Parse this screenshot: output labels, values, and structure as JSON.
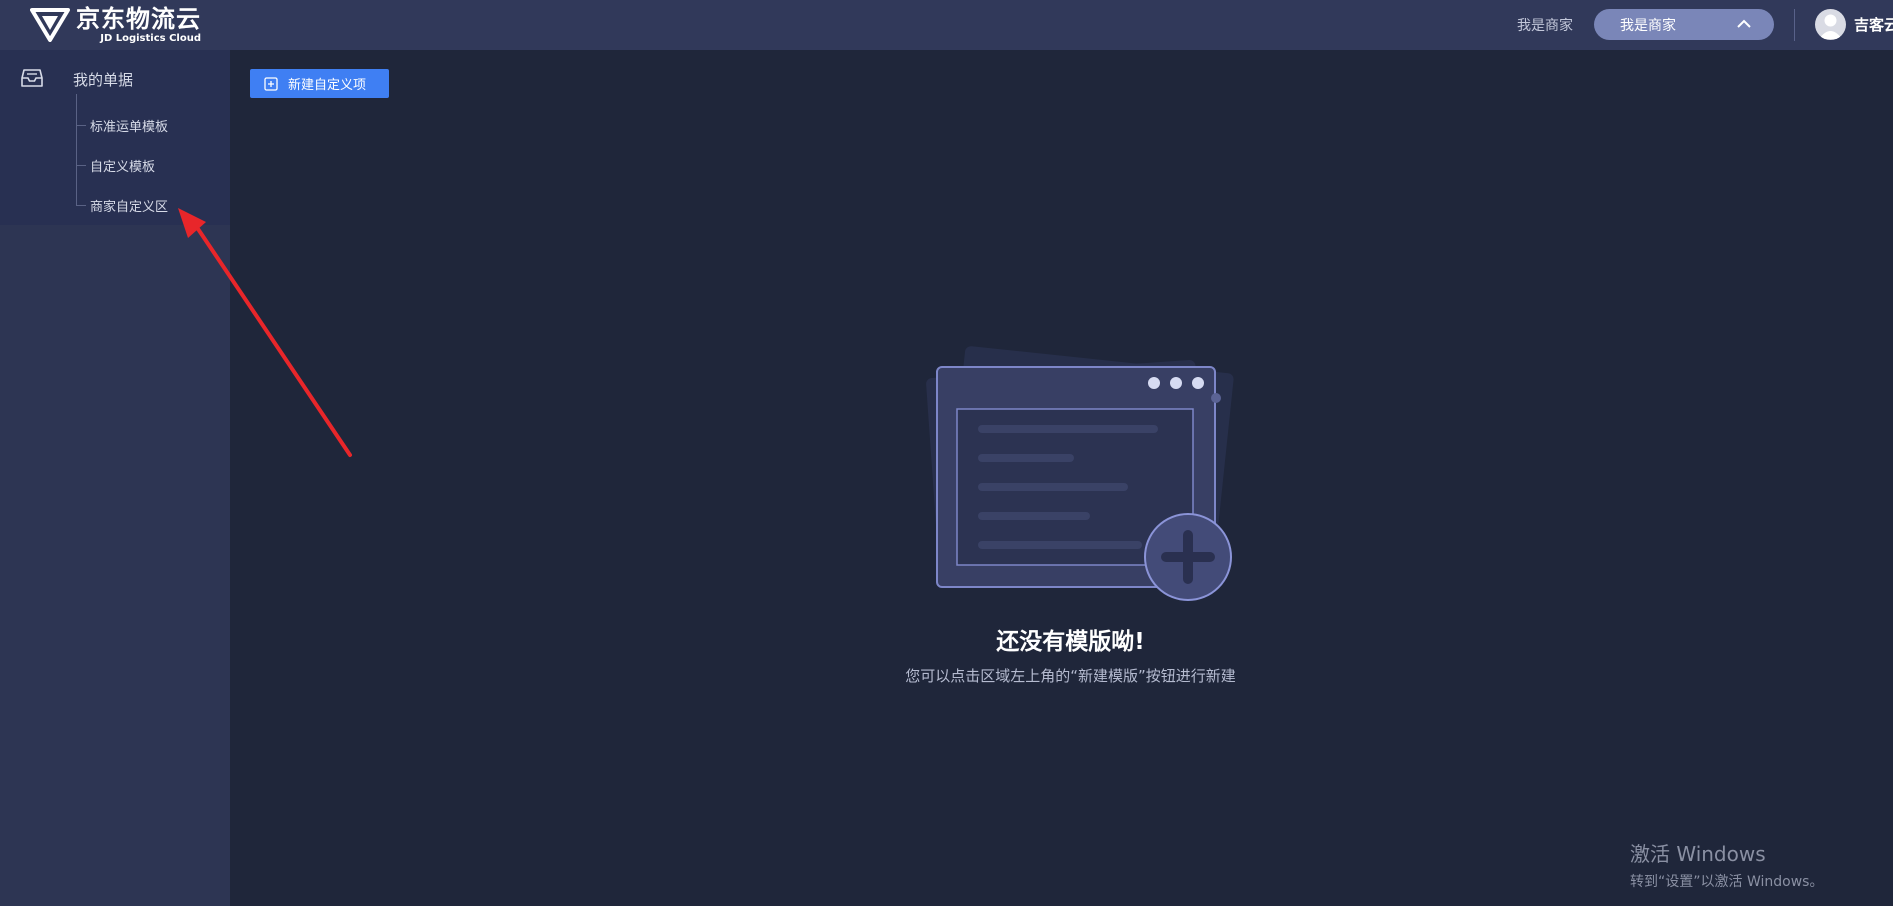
{
  "header": {
    "logo_cn": "京东物流云",
    "logo_en": "JD Logistics Cloud",
    "merchant_link": "我是商家",
    "merchant_select": "我是商家",
    "user_name": "吉客云"
  },
  "sidebar": {
    "group_label": "我的单据",
    "items": [
      {
        "label": "标准运单模板"
      },
      {
        "label": "自定义模板"
      },
      {
        "label": "商家自定义区"
      }
    ]
  },
  "main": {
    "new_button_label": "新建自定义项",
    "empty_title": "还没有模版呦!",
    "empty_desc": "您可以点击区域左上角的“新建模版”按钮进行新建"
  },
  "watermark": {
    "line1": "激活 Windows",
    "line2": "转到“设置”以激活 Windows。"
  },
  "colors": {
    "header_bg": "#31395a",
    "sidebar_bg": "#2d3553",
    "main_bg": "#1f263a",
    "primary_button": "#3f7ff3",
    "annotation_red": "#e8262a"
  },
  "icons": {
    "logo": "jd-logistics-logo-icon",
    "chevron": "chevron-up-icon",
    "avatar": "user-avatar-icon",
    "group": "inbox-tray-icon",
    "new": "plus-square-icon",
    "illustration": "empty-template-illustration"
  }
}
